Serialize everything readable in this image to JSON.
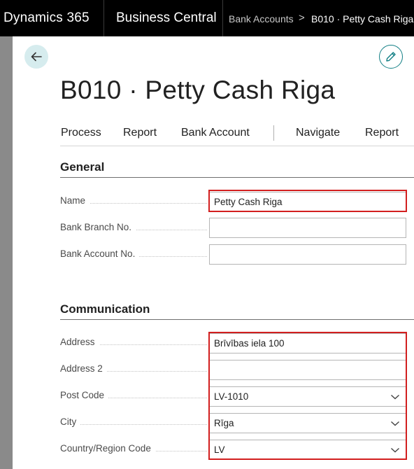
{
  "topbar": {
    "app_name": "Dynamics 365",
    "product_name": "Business Central",
    "breadcrumb": [
      "Bank Accounts",
      "B010 · Petty Cash Riga"
    ],
    "breadcrumb_separator": ">"
  },
  "page": {
    "title": "B010 · Petty Cash Riga",
    "back_icon": "arrow-left-icon",
    "edit_icon": "pencil-icon"
  },
  "actions": [
    "Process",
    "Report",
    "Bank Account",
    "Navigate",
    "Report"
  ],
  "general": {
    "title": "General",
    "fields": [
      {
        "label": "Name",
        "value": "Petty Cash Riga"
      },
      {
        "label": "Bank Branch No.",
        "value": ""
      },
      {
        "label": "Bank Account No.",
        "value": ""
      }
    ]
  },
  "communication": {
    "title": "Communication",
    "fields": [
      {
        "label": "Address",
        "value": "Brīvības iela 100"
      },
      {
        "label": "Address 2",
        "value": ""
      },
      {
        "label": "Post Code",
        "value": "LV-1010"
      },
      {
        "label": "City",
        "value": "Rīga"
      },
      {
        "label": "Country/Region Code",
        "value": "LV"
      }
    ]
  },
  "colors": {
    "accent": "#127f85",
    "highlight": "#d21f1f",
    "topbar_bg": "#000000"
  }
}
